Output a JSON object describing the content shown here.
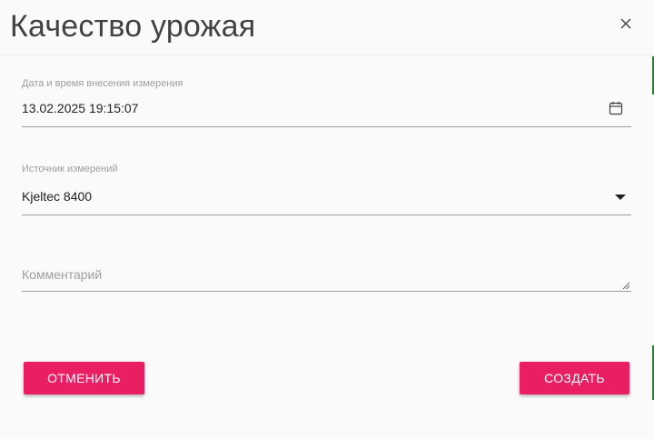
{
  "dialog": {
    "title": "Качество урожая",
    "close_icon": "close-icon"
  },
  "form": {
    "datetime": {
      "label": "Дата и время внесения измерения",
      "value": "13.02.2025 19:15:07",
      "icon": "calendar-icon"
    },
    "source": {
      "label": "Источник измерений",
      "value": "Kjeltec 8400",
      "icon": "dropdown-arrow-icon"
    },
    "comment": {
      "placeholder": "Комментарий",
      "value": ""
    }
  },
  "actions": {
    "cancel_label": "ОТМЕНИТЬ",
    "create_label": "СОЗДАТЬ"
  },
  "colors": {
    "accent": "#e91e63",
    "background": "#fafafa",
    "title_text": "#424242",
    "label_text": "#9e9e9e",
    "underline": "#9e9e9e"
  }
}
